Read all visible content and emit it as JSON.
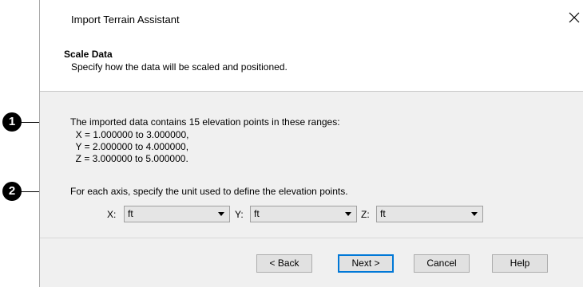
{
  "window": {
    "title": "Import Terrain Assistant"
  },
  "header": {
    "title": "Scale Data",
    "subtitle": "Specify how the data will be scaled and positioned."
  },
  "info": {
    "summary": "The imported data contains 15 elevation points in these ranges:",
    "x_range": "  X = 1.000000 to 3.000000,",
    "y_range": "  Y = 2.000000 to 4.000000,",
    "z_range": "  Z = 3.000000 to 5.000000.",
    "unit_prompt": "For each axis, specify the unit used to define the elevation points."
  },
  "units": {
    "x_label": "X:",
    "x_value": "ft",
    "y_label": "Y:",
    "y_value": "ft",
    "z_label": "Z:",
    "z_value": "ft"
  },
  "buttons": {
    "back": "< Back",
    "next": "Next >",
    "cancel": "Cancel",
    "help": "Help"
  },
  "callouts": {
    "one": "1",
    "two": "2"
  }
}
